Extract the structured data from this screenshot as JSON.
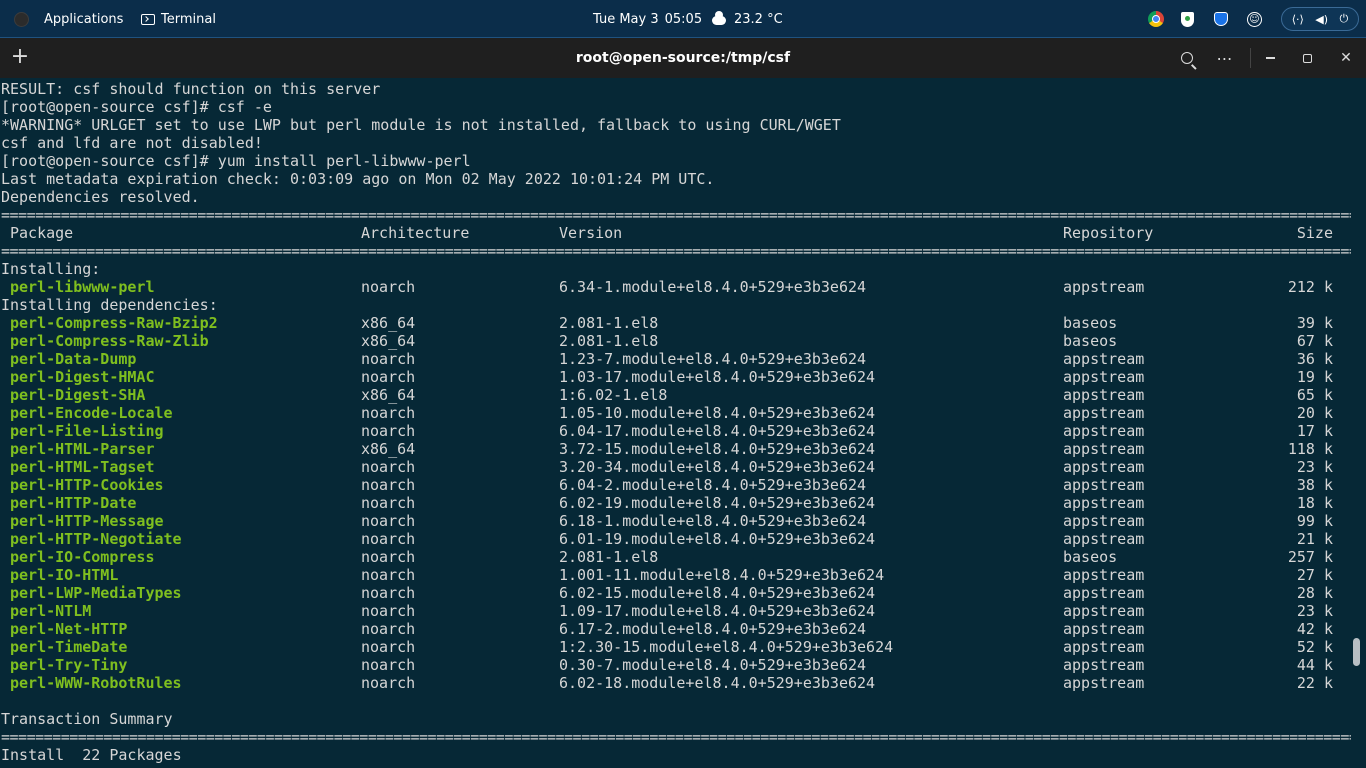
{
  "topbar": {
    "applications": "Applications",
    "terminal": "Terminal",
    "date": "Tue May 3",
    "time": "05:05",
    "temperature": "23.2 °C"
  },
  "window": {
    "title": "root@open-source:/tmp/csf"
  },
  "terminal": {
    "pre_lines": [
      "RESULT: csf should function on this server",
      "[root@open-source csf]# csf -e",
      "*WARNING* URLGET set to use LWP but perl module is not installed, fallback to using CURL/WGET",
      "csf and lfd are not disabled!",
      "[root@open-source csf]# yum install perl-libwww-perl",
      "Last metadata expiration check: 0:03:09 ago on Mon 02 May 2022 10:01:24 PM UTC.",
      "Dependencies resolved."
    ],
    "headers": {
      "package": "Package",
      "arch": "Architecture",
      "version": "Version",
      "repo": "Repository",
      "size": "Size"
    },
    "installing_label": "Installing:",
    "installing": [
      {
        "name": "perl-libwww-perl",
        "arch": "noarch",
        "version": "6.34-1.module+el8.4.0+529+e3b3e624",
        "repo": "appstream",
        "size": "212 k"
      }
    ],
    "deps_label": "Installing dependencies:",
    "deps": [
      {
        "name": "perl-Compress-Raw-Bzip2",
        "arch": "x86_64",
        "version": "2.081-1.el8",
        "repo": "baseos",
        "size": "39 k"
      },
      {
        "name": "perl-Compress-Raw-Zlib",
        "arch": "x86_64",
        "version": "2.081-1.el8",
        "repo": "baseos",
        "size": "67 k"
      },
      {
        "name": "perl-Data-Dump",
        "arch": "noarch",
        "version": "1.23-7.module+el8.4.0+529+e3b3e624",
        "repo": "appstream",
        "size": "36 k"
      },
      {
        "name": "perl-Digest-HMAC",
        "arch": "noarch",
        "version": "1.03-17.module+el8.4.0+529+e3b3e624",
        "repo": "appstream",
        "size": "19 k"
      },
      {
        "name": "perl-Digest-SHA",
        "arch": "x86_64",
        "version": "1:6.02-1.el8",
        "repo": "appstream",
        "size": "65 k"
      },
      {
        "name": "perl-Encode-Locale",
        "arch": "noarch",
        "version": "1.05-10.module+el8.4.0+529+e3b3e624",
        "repo": "appstream",
        "size": "20 k"
      },
      {
        "name": "perl-File-Listing",
        "arch": "noarch",
        "version": "6.04-17.module+el8.4.0+529+e3b3e624",
        "repo": "appstream",
        "size": "17 k"
      },
      {
        "name": "perl-HTML-Parser",
        "arch": "x86_64",
        "version": "3.72-15.module+el8.4.0+529+e3b3e624",
        "repo": "appstream",
        "size": "118 k"
      },
      {
        "name": "perl-HTML-Tagset",
        "arch": "noarch",
        "version": "3.20-34.module+el8.4.0+529+e3b3e624",
        "repo": "appstream",
        "size": "23 k"
      },
      {
        "name": "perl-HTTP-Cookies",
        "arch": "noarch",
        "version": "6.04-2.module+el8.4.0+529+e3b3e624",
        "repo": "appstream",
        "size": "38 k"
      },
      {
        "name": "perl-HTTP-Date",
        "arch": "noarch",
        "version": "6.02-19.module+el8.4.0+529+e3b3e624",
        "repo": "appstream",
        "size": "18 k"
      },
      {
        "name": "perl-HTTP-Message",
        "arch": "noarch",
        "version": "6.18-1.module+el8.4.0+529+e3b3e624",
        "repo": "appstream",
        "size": "99 k"
      },
      {
        "name": "perl-HTTP-Negotiate",
        "arch": "noarch",
        "version": "6.01-19.module+el8.4.0+529+e3b3e624",
        "repo": "appstream",
        "size": "21 k"
      },
      {
        "name": "perl-IO-Compress",
        "arch": "noarch",
        "version": "2.081-1.el8",
        "repo": "baseos",
        "size": "257 k"
      },
      {
        "name": "perl-IO-HTML",
        "arch": "noarch",
        "version": "1.001-11.module+el8.4.0+529+e3b3e624",
        "repo": "appstream",
        "size": "27 k"
      },
      {
        "name": "perl-LWP-MediaTypes",
        "arch": "noarch",
        "version": "6.02-15.module+el8.4.0+529+e3b3e624",
        "repo": "appstream",
        "size": "28 k"
      },
      {
        "name": "perl-NTLM",
        "arch": "noarch",
        "version": "1.09-17.module+el8.4.0+529+e3b3e624",
        "repo": "appstream",
        "size": "23 k"
      },
      {
        "name": "perl-Net-HTTP",
        "arch": "noarch",
        "version": "6.17-2.module+el8.4.0+529+e3b3e624",
        "repo": "appstream",
        "size": "42 k"
      },
      {
        "name": "perl-TimeDate",
        "arch": "noarch",
        "version": "1:2.30-15.module+el8.4.0+529+e3b3e624",
        "repo": "appstream",
        "size": "52 k"
      },
      {
        "name": "perl-Try-Tiny",
        "arch": "noarch",
        "version": "0.30-7.module+el8.4.0+529+e3b3e624",
        "repo": "appstream",
        "size": "44 k"
      },
      {
        "name": "perl-WWW-RobotRules",
        "arch": "noarch",
        "version": "6.02-18.module+el8.4.0+529+e3b3e624",
        "repo": "appstream",
        "size": "22 k"
      }
    ],
    "summary_label": "Transaction Summary",
    "install_summary": "Install  22 Packages",
    "separator_char": "="
  },
  "colors": {
    "topbar_bg": "#0b2d4a",
    "terminal_bg": "#062836",
    "package_green": "#7fbf1f",
    "text": "#d6d6d6"
  }
}
